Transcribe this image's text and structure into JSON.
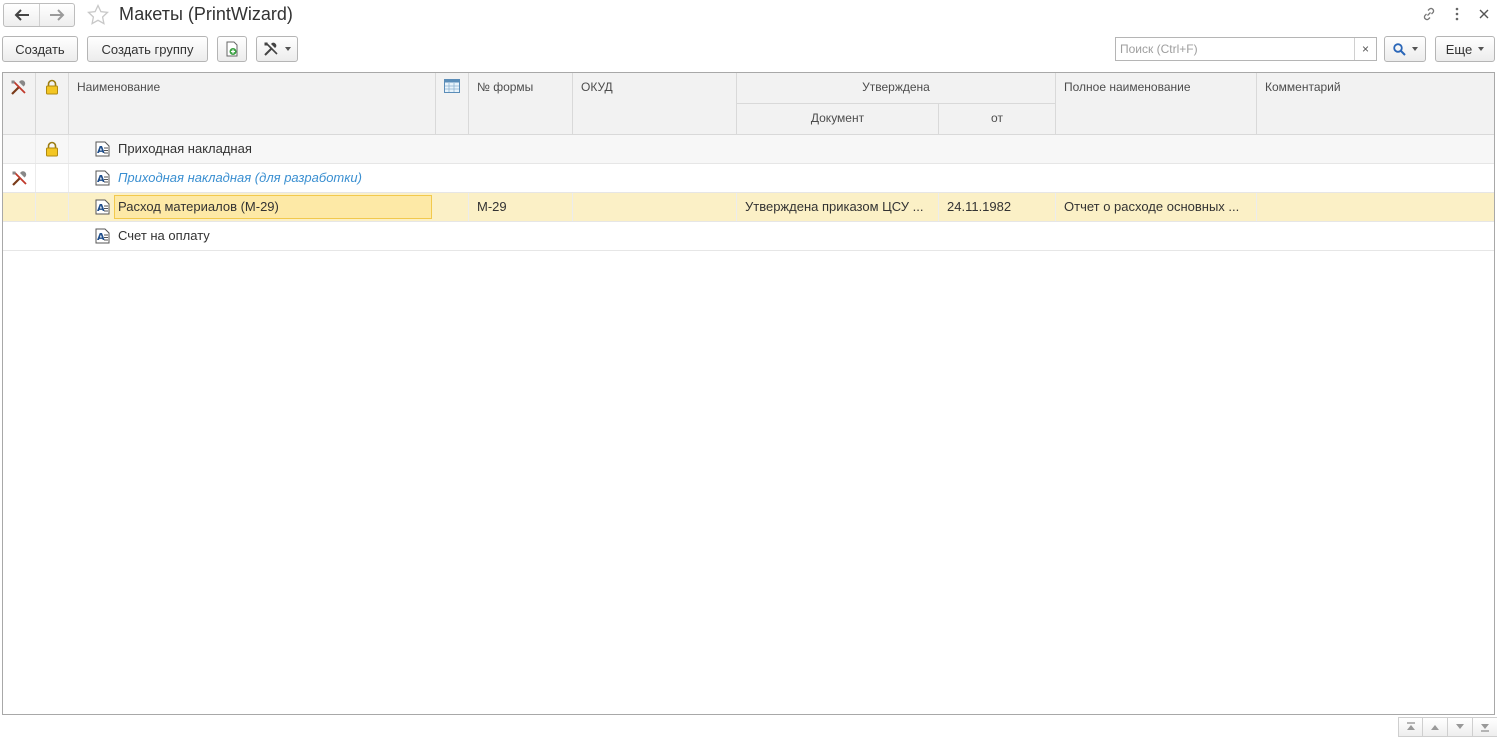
{
  "window": {
    "title": "Макеты (PrintWizard)"
  },
  "toolbar": {
    "create_label": "Создать",
    "create_group_label": "Создать группу",
    "more_label": "Еще",
    "search_placeholder": "Поиск (Ctrl+F)",
    "search_clear": "×"
  },
  "table": {
    "headers": {
      "name": "Наименование",
      "form_no": "№ формы",
      "okud": "ОКУД",
      "approved": "Утверждена",
      "approved_document": "Документ",
      "approved_from": "от",
      "full_name": "Полное наименование",
      "comment": "Комментарий"
    },
    "rows": [
      {
        "name": "Приходная накладная",
        "form_no": "",
        "okud": "",
        "approved_document": "",
        "approved_from": "",
        "full_name": "",
        "comment": "",
        "locked": true,
        "dev": false,
        "italic": false,
        "selected": false
      },
      {
        "name": "Приходная накладная (для разработки)",
        "form_no": "",
        "okud": "",
        "approved_document": "",
        "approved_from": "",
        "full_name": "",
        "comment": "",
        "locked": false,
        "dev": true,
        "italic": true,
        "selected": false
      },
      {
        "name": "Расход материалов (М-29)",
        "form_no": "М-29",
        "okud": "",
        "approved_document": "Утверждена приказом ЦСУ ...",
        "approved_from": "24.11.1982",
        "full_name": "Отчет о расходе основных ...",
        "comment": "",
        "locked": false,
        "dev": false,
        "italic": false,
        "selected": true
      },
      {
        "name": "Счет на оплату",
        "form_no": "",
        "okud": "",
        "approved_document": "",
        "approved_from": "",
        "full_name": "",
        "comment": "",
        "locked": false,
        "dev": false,
        "italic": false,
        "selected": false
      }
    ]
  },
  "colors": {
    "selected_row": "#fbf0c6",
    "focus_border": "#f2c94c",
    "italic_link": "#3a8fd1",
    "header_bg": "#f2f2f2"
  },
  "icons": {
    "back": "arrow-left-icon",
    "forward": "arrow-right-icon",
    "favorite": "star-icon",
    "link": "link-icon",
    "menu": "kebab-menu-icon",
    "close": "close-icon",
    "new_layout": "new-document-icon",
    "tools": "tools-icon",
    "search": "magnifier-icon",
    "dev_column": "tools-icon",
    "lock_column": "lock-icon",
    "picture_column": "table-picture-icon",
    "layout_item": "document-layout-icon"
  }
}
